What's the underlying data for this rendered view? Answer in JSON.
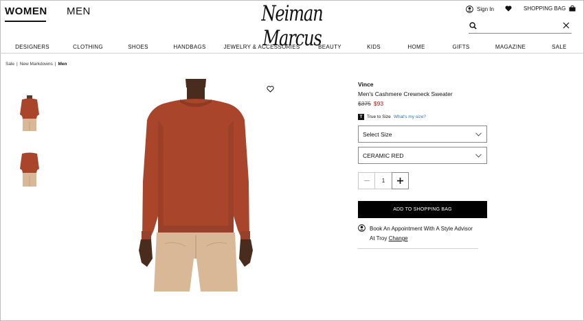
{
  "header": {
    "women_label": "WOMEN",
    "men_label": "MEN",
    "logo_text": "Neiman Marcus",
    "sign_in_label": "Sign In",
    "shopping_bag_label": "SHOPPING BAG",
    "search_placeholder": ""
  },
  "nav": {
    "items": [
      "DESIGNERS",
      "CLOTHING",
      "SHOES",
      "HANDBAGS",
      "JEWELRY & ACCESSORIES",
      "BEAUTY",
      "KIDS",
      "HOME",
      "GIFTS",
      "MAGAZINE",
      "SALE"
    ]
  },
  "breadcrumb": {
    "items": [
      "Sale",
      "New Markdowns",
      "Men"
    ],
    "separator": "|"
  },
  "product": {
    "brand": "Vince",
    "name": "Men's Cashmere Crewneck Sweater",
    "original_price": "$375",
    "sale_price": "$93",
    "fit_badge": "T",
    "fit_label": "True to Size",
    "fit_link": "What's my size?",
    "size_select": "Select Size",
    "color_select": "CERAMIC RED",
    "quantity": "1",
    "add_to_bag": "ADD TO SHOPPING BAG",
    "appointment_text": "Book An Appointment With A Style Advisor At Troy",
    "appointment_link": "Change"
  },
  "icons": {
    "account": "user-circle-icon",
    "wishlist_header": "heart-icon",
    "bag": "shopping-bag-icon",
    "search": "search-icon",
    "clear": "close-icon",
    "wishlist_product": "heart-outline-icon",
    "dropdown": "chevron-down-icon",
    "minus": "minus-icon",
    "plus": "plus-icon",
    "advisor": "person-icon"
  },
  "colors": {
    "sale_price": "#b3141b",
    "link": "#2b6cb0",
    "sweater": "#a8452a",
    "pants": "#d8b896",
    "button_bg": "#000000"
  }
}
